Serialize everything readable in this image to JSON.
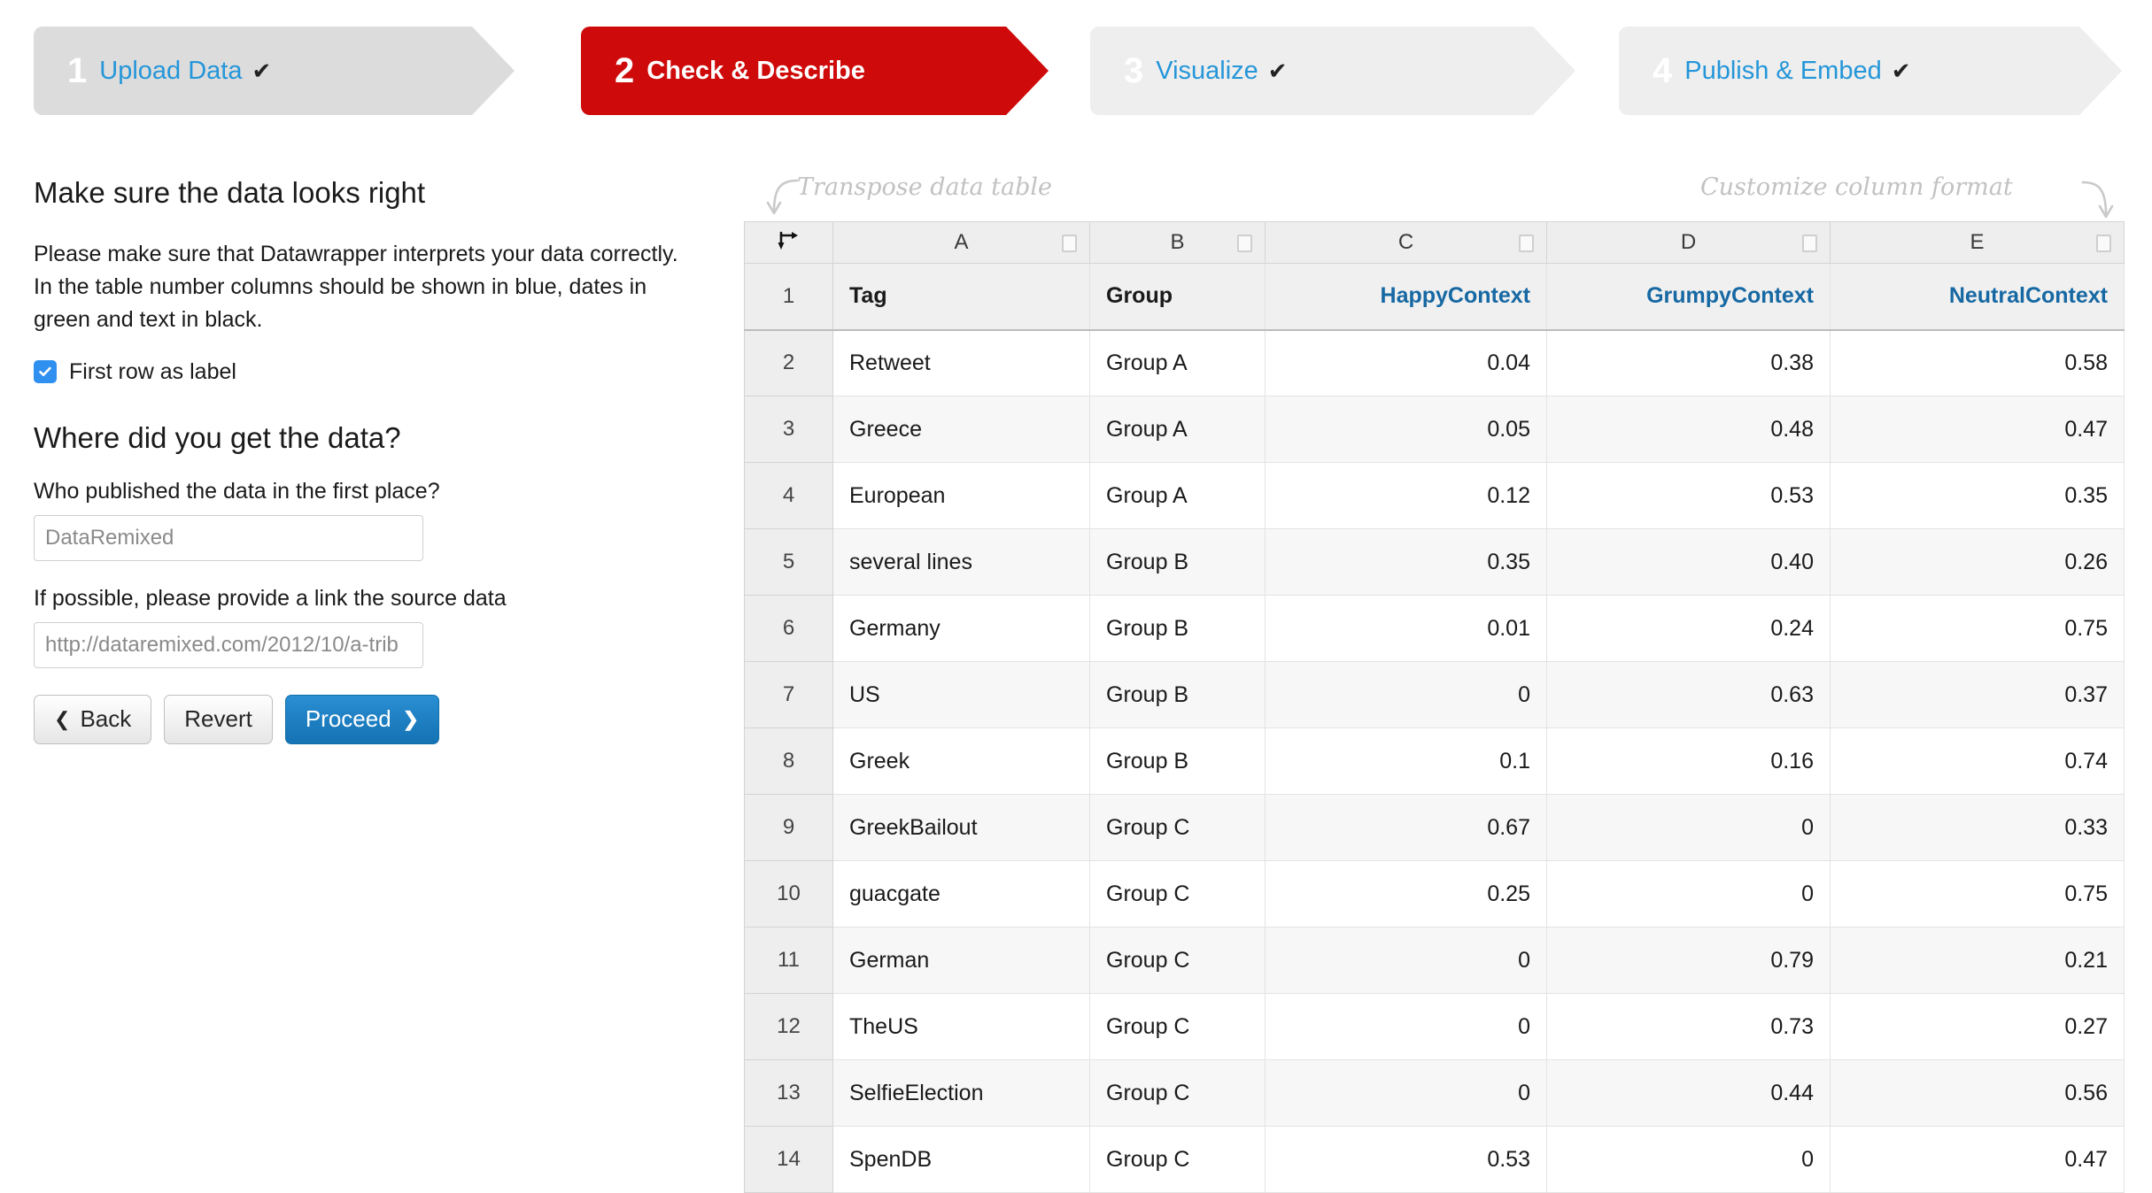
{
  "steps": [
    {
      "number": "1",
      "label": "Upload Data",
      "check": "✔",
      "state": "done"
    },
    {
      "number": "2",
      "label": "Check & Describe",
      "check": "",
      "state": "active"
    },
    {
      "number": "3",
      "label": "Visualize",
      "check": "✔",
      "state": "light"
    },
    {
      "number": "4",
      "label": "Publish & Embed",
      "check": "✔",
      "state": "light"
    }
  ],
  "left_panel": {
    "heading": "Make sure the data looks right",
    "paragraph": "Please make sure that Datawrapper interprets your data correctly. In the table number columns should be shown in blue, dates in green and text in black.",
    "checkbox_label": "First row as label",
    "checkbox_checked": true,
    "source_heading": "Where did you get the data?",
    "publisher_label": "Who published the data in the first place?",
    "publisher_value": "DataRemixed",
    "link_label": "If possible, please provide a link the source data",
    "link_value": "http://dataremixed.com/2012/10/a-trib",
    "buttons": {
      "back": "Back",
      "back_icon": "❮",
      "revert": "Revert",
      "proceed": "Proceed",
      "proceed_icon": "❯"
    }
  },
  "annotations": {
    "transpose": "Transpose data table",
    "customize": "Customize column format"
  },
  "table": {
    "transpose_icon": "transpose-arrow-icon",
    "column_letters": [
      "A",
      "B",
      "C",
      "D",
      "E"
    ],
    "label_row_number": "1",
    "label_row": [
      "Tag",
      "Group",
      "HappyContext",
      "GrumpyContext",
      "NeutralContext"
    ],
    "rows": [
      {
        "n": "2",
        "cells": [
          "Retweet",
          "Group A",
          "0.04",
          "0.38",
          "0.58"
        ]
      },
      {
        "n": "3",
        "cells": [
          "Greece",
          "Group A",
          "0.05",
          "0.48",
          "0.47"
        ]
      },
      {
        "n": "4",
        "cells": [
          "European",
          "Group A",
          "0.12",
          "0.53",
          "0.35"
        ]
      },
      {
        "n": "5",
        "cells": [
          "several lines",
          "Group B",
          "0.35",
          "0.40",
          "0.26"
        ]
      },
      {
        "n": "6",
        "cells": [
          "Germany",
          "Group B",
          "0.01",
          "0.24",
          "0.75"
        ]
      },
      {
        "n": "7",
        "cells": [
          "US",
          "Group B",
          "0",
          "0.63",
          "0.37"
        ]
      },
      {
        "n": "8",
        "cells": [
          "Greek",
          "Group B",
          "0.1",
          "0.16",
          "0.74"
        ]
      },
      {
        "n": "9",
        "cells": [
          "GreekBailout",
          "Group C",
          "0.67",
          "0",
          "0.33"
        ]
      },
      {
        "n": "10",
        "cells": [
          "guacgate",
          "Group C",
          "0.25",
          "0",
          "0.75"
        ]
      },
      {
        "n": "11",
        "cells": [
          "German",
          "Group C",
          "0",
          "0.79",
          "0.21"
        ]
      },
      {
        "n": "12",
        "cells": [
          "TheUS",
          "Group C",
          "0",
          "0.73",
          "0.27"
        ]
      },
      {
        "n": "13",
        "cells": [
          "SelfieElection",
          "Group C",
          "0",
          "0.44",
          "0.56"
        ]
      },
      {
        "n": "14",
        "cells": [
          "SpenDB",
          "Group C",
          "0.53",
          "0",
          "0.47"
        ]
      }
    ]
  },
  "colors": {
    "active_step": "#cf0a0a",
    "link_blue": "#2496d9",
    "number_blue": "#2580b8",
    "checkbox_blue": "#2f90f0",
    "primary_button": "#1d7ec0"
  }
}
